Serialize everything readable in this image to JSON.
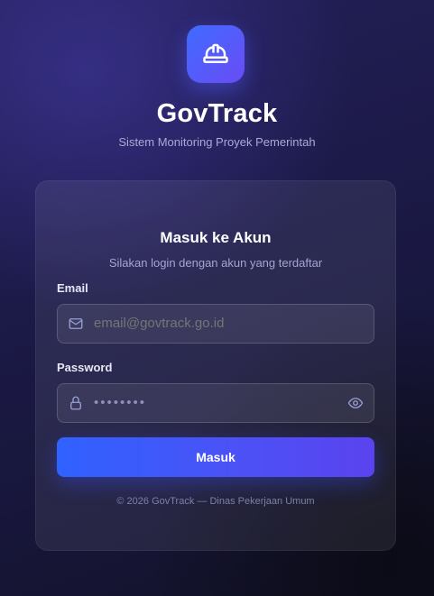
{
  "brand": {
    "icon": "hard-hat-icon",
    "title": "GovTrack",
    "subtitle": "Sistem Monitoring Proyek Pemerintah"
  },
  "login": {
    "title": "Masuk ke Akun",
    "subtitle": "Silakan login dengan akun yang terdaftar",
    "email": {
      "label": "Email",
      "icon": "mail-icon",
      "placeholder": "email@govtrack.go.id",
      "value": ""
    },
    "password": {
      "label": "Password",
      "icon": "lock-icon",
      "value_masked": "••••••••",
      "toggle_icon": "eye-icon"
    },
    "submit_label": "Masuk",
    "footer": "© 2026 GovTrack — Dinas Pekerjaan Umum"
  },
  "colors": {
    "accent_start": "#2f62ff",
    "accent_end": "#5a43ef",
    "background": "#1c1a48"
  }
}
